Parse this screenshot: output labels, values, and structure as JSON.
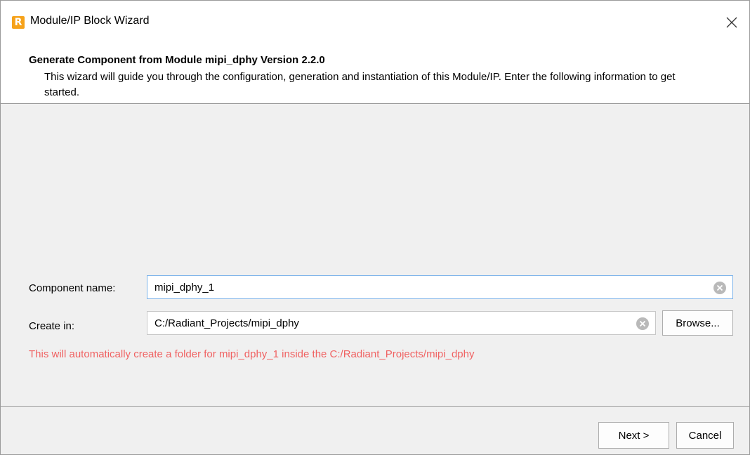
{
  "window": {
    "title": "Module/IP Block Wizard",
    "app_icon_letter": "R",
    "close_icon": "close-icon"
  },
  "header": {
    "title": "Generate Component from Module mipi_dphy Version 2.2.0",
    "description": "This wizard will guide you through the configuration, generation and instantiation of this Module/IP. Enter the following information to get started."
  },
  "form": {
    "component_name": {
      "label": "Component name:",
      "value": "mipi_dphy_1"
    },
    "create_in": {
      "label": "Create in:",
      "value": "C:/Radiant_Projects/mipi_dphy",
      "browse_label": "Browse..."
    },
    "warning": "This will automatically create a folder for mipi_dphy_1 inside the C:/Radiant_Projects/mipi_dphy"
  },
  "footer": {
    "next_label": "Next >",
    "cancel_label": "Cancel"
  },
  "colors": {
    "accent_focus": "#7eb4ea",
    "warning_text": "#f06262",
    "app_icon": "#f6a21a"
  }
}
